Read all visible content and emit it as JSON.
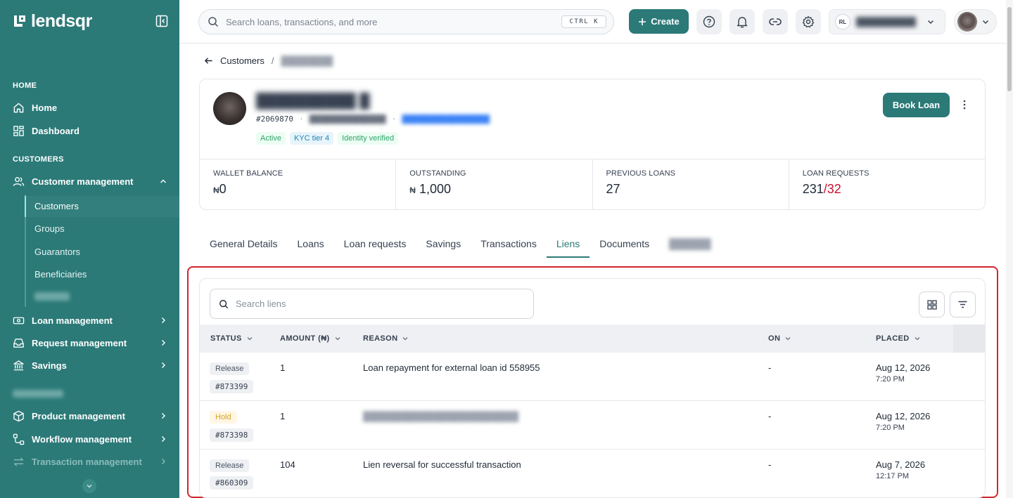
{
  "sidebar": {
    "brand": "lendsqr",
    "sections": {
      "home": "HOME",
      "customers": "CUSTOMERS"
    },
    "items": {
      "home": "Home",
      "dashboard": "Dashboard",
      "customer_management": "Customer management",
      "loan_management": "Loan management",
      "request_management": "Request management",
      "savings": "Savings",
      "product_management": "Product management",
      "workflow_management": "Workflow management",
      "transaction_management": "Transaction management"
    },
    "sub_items": {
      "customers": "Customers",
      "groups": "Groups",
      "guarantors": "Guarantors",
      "beneficiaries": "Beneficiaries"
    }
  },
  "topbar": {
    "search_placeholder": "Search loans, transactions, and more",
    "shortcut": "CTRL K",
    "create_label": "Create",
    "org_initials": "RL"
  },
  "breadcrumb": {
    "root": "Customers",
    "separator": "/"
  },
  "profile": {
    "customer_id": "#2069870",
    "badges": {
      "status": "Active",
      "kyc": "KYC tier 4",
      "identity": "Identity verified"
    },
    "book_loan_label": "Book Loan"
  },
  "stats": {
    "wallet_balance": {
      "label": "WALLET BALANCE",
      "currency": "₦",
      "value": "0"
    },
    "outstanding": {
      "label": "OUTSTANDING",
      "currency": "₦",
      "value": "1,000"
    },
    "previous_loans": {
      "label": "PREVIOUS LOANS",
      "value": "27"
    },
    "loan_requests": {
      "label": "LOAN REQUESTS",
      "value": "231",
      "value_alt": "/32",
      "alt_color": "#c8102e"
    }
  },
  "tabs": {
    "general": "General Details",
    "loans": "Loans",
    "loan_requests": "Loan requests",
    "savings": "Savings",
    "transactions": "Transactions",
    "liens": "Liens",
    "documents": "Documents",
    "active": "Liens"
  },
  "liens": {
    "search_placeholder": "Search liens",
    "columns": {
      "status": "STATUS",
      "amount": "AMOUNT (₦)",
      "reason": "REASON",
      "on": "ON",
      "placed": "PLACED"
    },
    "rows": [
      {
        "status": "Release",
        "id": "#873399",
        "amount": "1",
        "reason": "Loan repayment for external loan id 558955",
        "on": "-",
        "date": "Aug 12, 2026",
        "time": "7:20 PM"
      },
      {
        "status": "Hold",
        "id": "#873398",
        "amount": "1",
        "reason": "",
        "on": "-",
        "date": "Aug 12, 2026",
        "time": "7:20 PM"
      },
      {
        "status": "Release",
        "id": "#860309",
        "amount": "104",
        "reason": "Lien reversal for successful transaction",
        "on": "-",
        "date": "Aug 7, 2026",
        "time": "12:17 PM"
      }
    ]
  },
  "colors": {
    "brand": "#2b7a78",
    "highlight": "#d0282e",
    "hold": "#d6a21c"
  },
  "icons": [
    "search-icon",
    "plus-icon",
    "help-icon",
    "bell-icon",
    "link-icon",
    "gear-icon",
    "chevron-down-icon",
    "arrow-left-icon",
    "more-vertical-icon",
    "grid-icon",
    "filter-icon"
  ]
}
